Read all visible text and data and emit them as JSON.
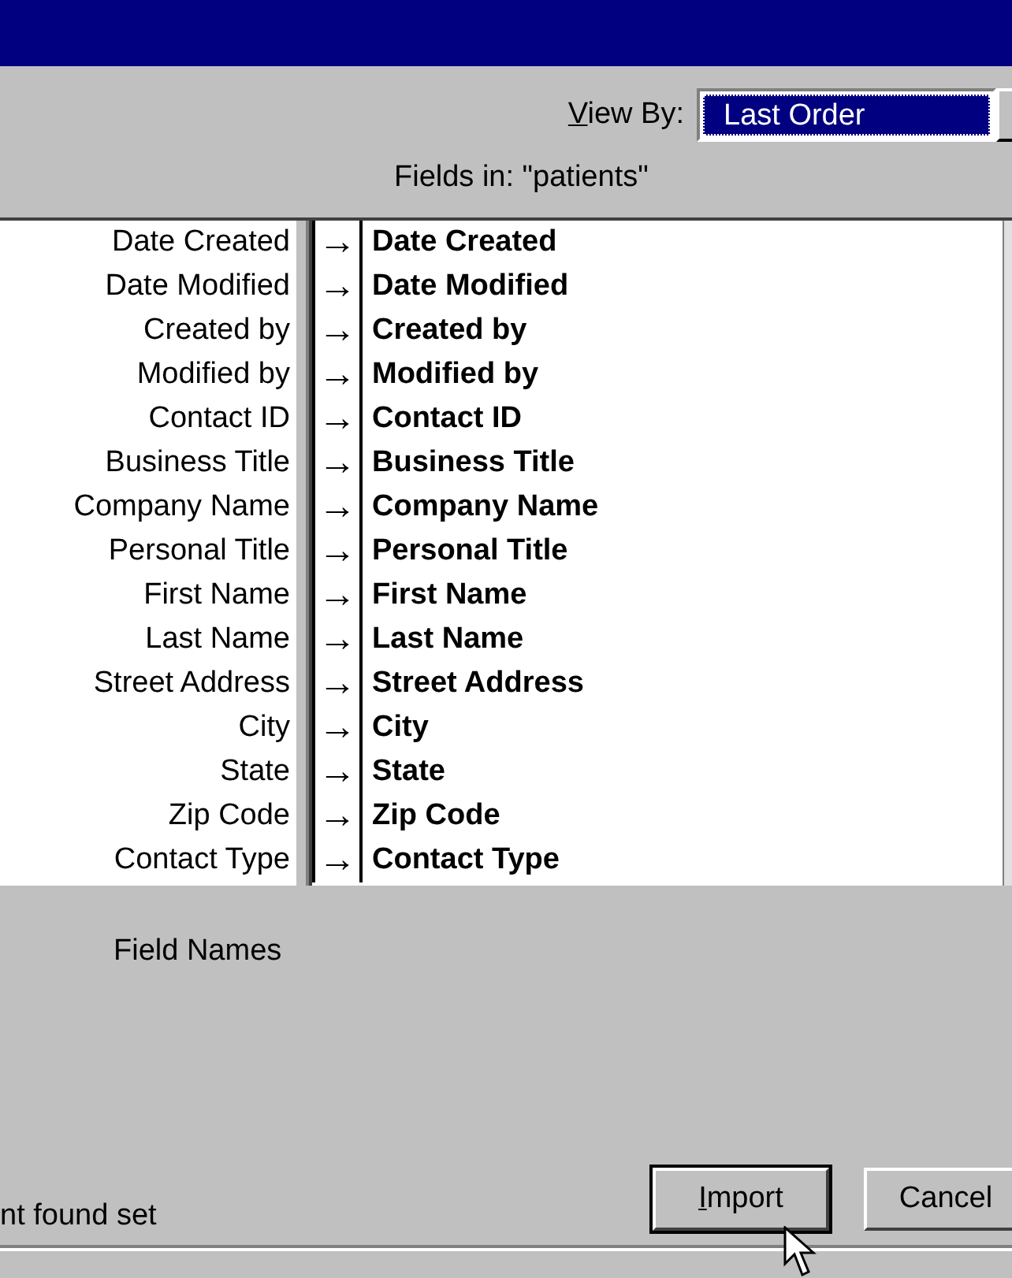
{
  "view_by": {
    "label": "View By:",
    "first_letter_underlined": true,
    "value": "Last Order"
  },
  "fields_caption": "Fields in: \"patients\"",
  "mappings": [
    {
      "source": "Date Created",
      "arrow": "→",
      "target": "Date Created"
    },
    {
      "source": "Date Modified",
      "arrow": "→",
      "target": "Date Modified"
    },
    {
      "source": "Created by",
      "arrow": "→",
      "target": "Created by"
    },
    {
      "source": "Modified by",
      "arrow": "→",
      "target": "Modified by"
    },
    {
      "source": "Contact ID",
      "arrow": "→",
      "target": "Contact ID"
    },
    {
      "source": "Business Title",
      "arrow": "→",
      "target": "Business Title"
    },
    {
      "source": "Company Name",
      "arrow": "→",
      "target": "Company Name"
    },
    {
      "source": "Personal Title",
      "arrow": "→",
      "target": "Personal Title"
    },
    {
      "source": "First Name",
      "arrow": "→",
      "target": "First Name"
    },
    {
      "source": "Last Name",
      "arrow": "→",
      "target": "Last Name"
    },
    {
      "source": "Street Address",
      "arrow": "→",
      "target": "Street Address"
    },
    {
      "source": "City",
      "arrow": "→",
      "target": "City"
    },
    {
      "source": "State",
      "arrow": "→",
      "target": "State"
    },
    {
      "source": "Zip Code",
      "arrow": "→",
      "target": "Zip Code"
    },
    {
      "source": "Contact Type",
      "arrow": "→",
      "target": "Contact Type"
    }
  ],
  "field_names_label": "Field Names",
  "status_text": "nt found set",
  "buttons": [
    {
      "label": "Import",
      "first_letter_underlined": true,
      "default": true
    },
    {
      "label": "Cancel",
      "first_letter_underlined": false,
      "default": false
    }
  ]
}
